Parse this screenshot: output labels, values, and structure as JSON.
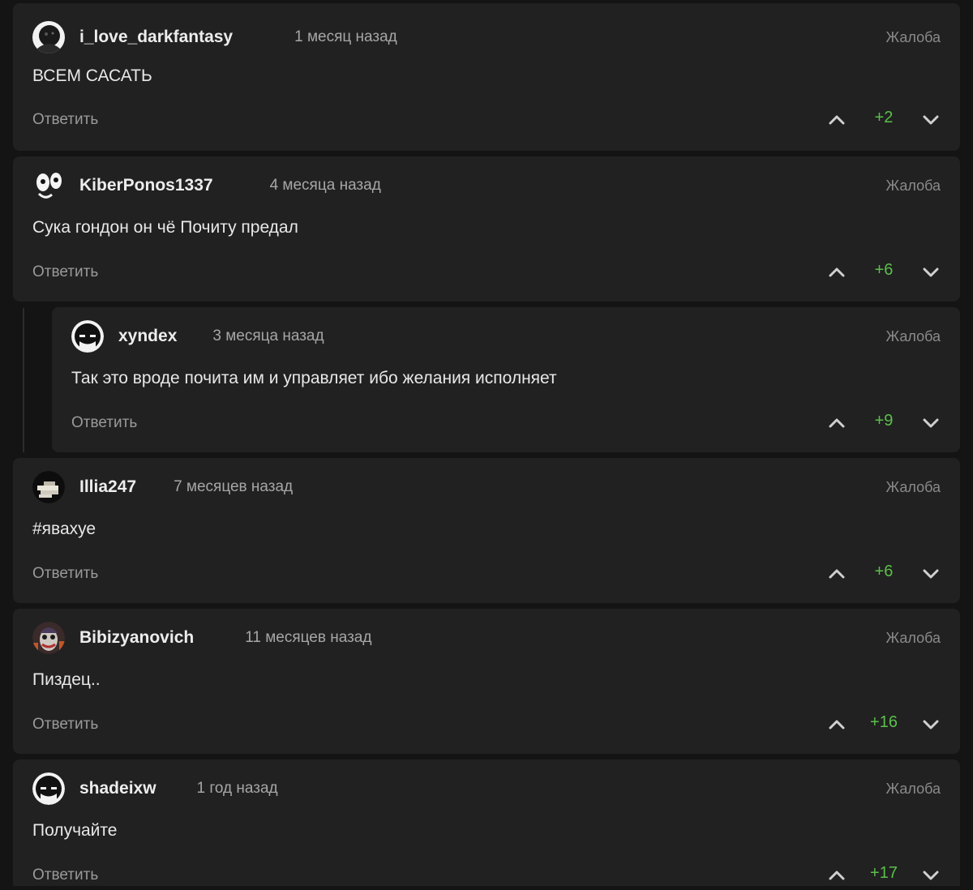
{
  "labels": {
    "report": "Жалоба",
    "reply": "Ответить"
  },
  "colors": {
    "background": "#141414",
    "card": "#212121",
    "score_positive": "#5bbf4a"
  },
  "comments": [
    {
      "username": "i_love_darkfantasy",
      "time": "1 месяц назад",
      "text": "ВСЕМ САСАТЬ",
      "score": "+2",
      "avatar_icon": "dark-fantasy-avatar-icon"
    },
    {
      "username": "KiberPonos1337",
      "time": "4 месяца назад",
      "text": "Сука гондон он чё Почиту предал",
      "score": "+6",
      "avatar_icon": "cartoon-face-avatar-icon"
    },
    {
      "username": "xyndex",
      "time": "3 месяца назад",
      "text": "Так это вроде почита им и управляет ибо желания исполняет",
      "score": "+9",
      "avatar_icon": "batman-avatar-icon",
      "is_reply": true
    },
    {
      "username": "Illia247",
      "time": "7 месяцев назад",
      "text": "#явахуе",
      "score": "+6",
      "avatar_icon": "glitch-avatar-icon"
    },
    {
      "username": "Bibizyanovich",
      "time": "11 месяцев назад",
      "text": "Пиздец..",
      "score": "+16",
      "avatar_icon": "joker-avatar-icon"
    },
    {
      "username": "shadeixw",
      "time": "1 год назад",
      "text": "Получайте",
      "score": "+17",
      "avatar_icon": "batman-avatar-icon"
    }
  ]
}
